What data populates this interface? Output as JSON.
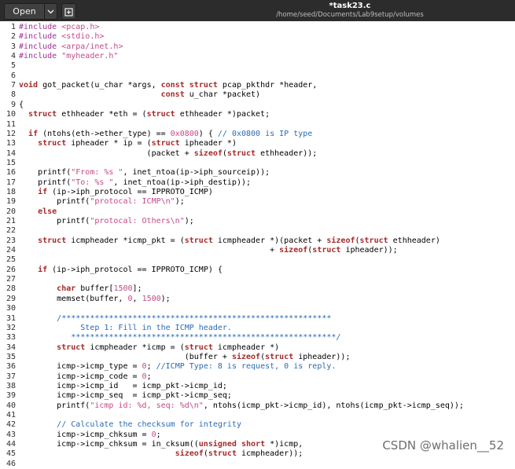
{
  "header": {
    "open_label": "Open",
    "title": "*task23.c",
    "subtitle": "/home/seed/Documents/Lab9setup/volumes"
  },
  "code_lines": [
    {
      "n": "1",
      "t": "#include <pcap.h>"
    },
    {
      "n": "2",
      "t": "#include <stdio.h>"
    },
    {
      "n": "3",
      "t": "#include <arpa/inet.h>"
    },
    {
      "n": "4",
      "t": "#include \"myheader.h\""
    },
    {
      "n": "5",
      "t": ""
    },
    {
      "n": "6",
      "t": ""
    },
    {
      "n": "7",
      "t": "void got_packet(u_char *args, const struct pcap_pkthdr *header,"
    },
    {
      "n": "8",
      "t": "                              const u_char *packet)"
    },
    {
      "n": "9",
      "t": "{"
    },
    {
      "n": "10",
      "t": "  struct ethheader *eth = (struct ethheader *)packet;"
    },
    {
      "n": "11",
      "t": ""
    },
    {
      "n": "12",
      "t": "  if (ntohs(eth->ether_type) == 0x0800) { // 0x0800 is IP type"
    },
    {
      "n": "13",
      "t": "    struct ipheader * ip = (struct ipheader *)"
    },
    {
      "n": "14",
      "t": "                           (packet + sizeof(struct ethheader));"
    },
    {
      "n": "15",
      "t": ""
    },
    {
      "n": "16",
      "t": "    printf(\"From: %s \", inet_ntoa(ip->iph_sourceip));"
    },
    {
      "n": "17",
      "t": "    printf(\"To: %s \", inet_ntoa(ip->iph_destip));"
    },
    {
      "n": "18",
      "t": "    if (ip->iph_protocol == IPPROTO_ICMP)"
    },
    {
      "n": "19",
      "t": "        printf(\"protocal: ICMP\\n\");"
    },
    {
      "n": "20",
      "t": "    else"
    },
    {
      "n": "21",
      "t": "        printf(\"protocal: Others\\n\");"
    },
    {
      "n": "22",
      "t": ""
    },
    {
      "n": "23",
      "t": "    struct icmpheader *icmp_pkt = (struct icmpheader *)(packet + sizeof(struct ethheader)"
    },
    {
      "n": "24",
      "t": "                                                     + sizeof(struct ipheader));"
    },
    {
      "n": "25",
      "t": ""
    },
    {
      "n": "26",
      "t": "    if (ip->iph_protocol == IPPROTO_ICMP) {"
    },
    {
      "n": "27",
      "t": ""
    },
    {
      "n": "28",
      "t": "        char buffer[1500];"
    },
    {
      "n": "29",
      "t": "        memset(buffer, 0, 1500);"
    },
    {
      "n": "30",
      "t": ""
    },
    {
      "n": "31",
      "t": "        /*********************************************************"
    },
    {
      "n": "32",
      "t": "             Step 1: Fill in the ICMP header."
    },
    {
      "n": "33",
      "t": "           ********************************************************/"
    },
    {
      "n": "34",
      "t": "        struct icmpheader *icmp = (struct icmpheader *)"
    },
    {
      "n": "35",
      "t": "                                   (buffer + sizeof(struct ipheader));"
    },
    {
      "n": "36",
      "t": "        icmp->icmp_type = 0; //ICMP Type: 8 is request, 0 is reply."
    },
    {
      "n": "37",
      "t": "        icmp->icmp_code = 0;"
    },
    {
      "n": "38",
      "t": "        icmp->icmp_id   = icmp_pkt->icmp_id;"
    },
    {
      "n": "39",
      "t": "        icmp->icmp_seq  = icmp_pkt->icmp_seq;"
    },
    {
      "n": "40",
      "t": "        printf(\"icmp id: %d, seq: %d\\n\", ntohs(icmp_pkt->icmp_id), ntohs(icmp_pkt->icmp_seq));"
    },
    {
      "n": "41",
      "t": ""
    },
    {
      "n": "42",
      "t": "        // Calculate the checksum for integrity"
    },
    {
      "n": "43",
      "t": "        icmp->icmp_chksum = 0;"
    },
    {
      "n": "44",
      "t": "        icmp->icmp_chksum = in_cksum((unsigned short *)icmp,"
    },
    {
      "n": "45",
      "t": "                                 sizeof(struct icmpheader));"
    },
    {
      "n": "46",
      "t": ""
    }
  ],
  "watermark": "CSDN @whalien__52",
  "colors": {
    "keyword": "#a52a2a",
    "string": "#c4498a",
    "comment": "#2a6bb3",
    "preprocessor": "#a0309a"
  },
  "icons": {
    "dropdown": "chevron-down-icon",
    "new_document": "new-document-icon"
  }
}
